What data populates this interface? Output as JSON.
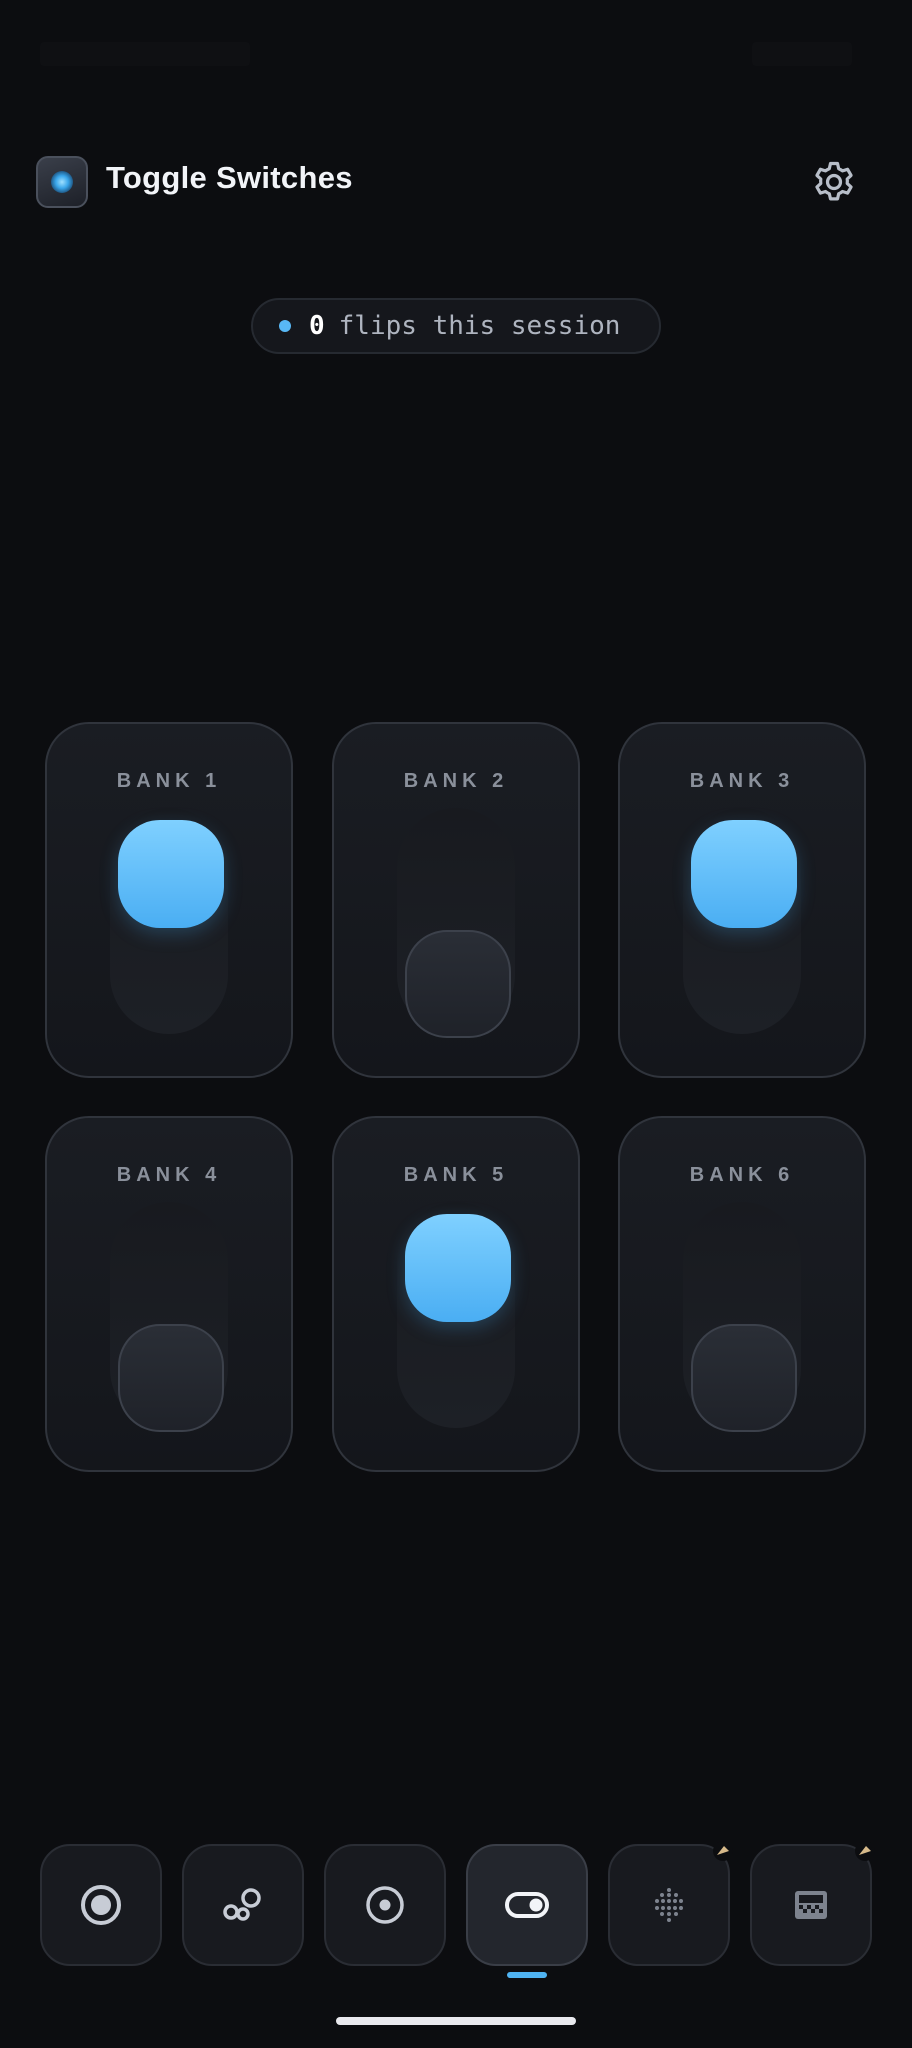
{
  "app": {
    "title": "Toggle Switches"
  },
  "session": {
    "count": "0",
    "label": "flips this session"
  },
  "banks": [
    {
      "label": "BANK 1",
      "on": true
    },
    {
      "label": "BANK 2",
      "on": false
    },
    {
      "label": "BANK 3",
      "on": true
    },
    {
      "label": "BANK 4",
      "on": false
    },
    {
      "label": "BANK 5",
      "on": true
    },
    {
      "label": "BANK 6",
      "on": false
    }
  ],
  "nav": {
    "items": [
      {
        "icon": "record-icon",
        "locked": false
      },
      {
        "icon": "bubbles-icon",
        "locked": false
      },
      {
        "icon": "target-icon",
        "locked": false
      },
      {
        "icon": "toggle-icon",
        "locked": false,
        "active": true
      },
      {
        "icon": "dot-grid-icon",
        "locked": true
      },
      {
        "icon": "checker-icon",
        "locked": true
      }
    ]
  },
  "colors": {
    "accent": "#58b8f5",
    "background": "#0c0d10",
    "card": "#1a1d23"
  }
}
